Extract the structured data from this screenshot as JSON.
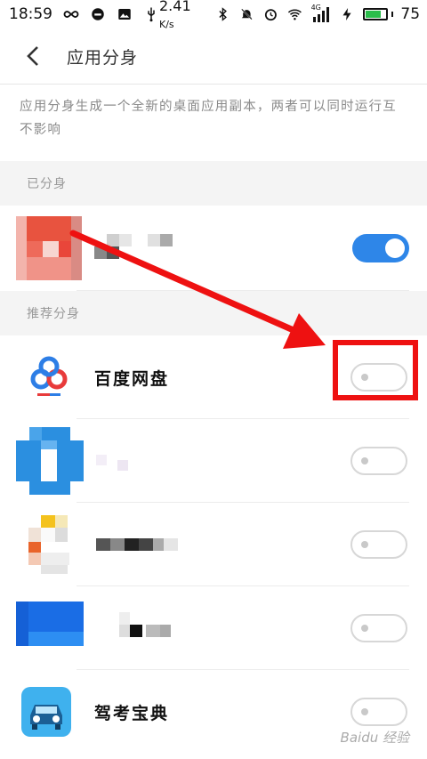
{
  "status_bar": {
    "time": "18:59",
    "speed": "2.41",
    "speed_unit": "K/s",
    "network": "4G",
    "battery_level": "75",
    "battery_fraction": 0.75
  },
  "header": {
    "title": "应用分身",
    "back_icon": "chevron-left-icon"
  },
  "description": "应用分身生成一个全新的桌面应用副本，两者可以同时运行互不影响",
  "sections": {
    "cloned": {
      "label": "已分身",
      "apps": [
        {
          "name": "",
          "enabled": true
        }
      ]
    },
    "recommended": {
      "label": "推荐分身",
      "apps": [
        {
          "name": "百度网盘",
          "enabled": false
        },
        {
          "name": "",
          "enabled": false
        },
        {
          "name": "",
          "enabled": false
        },
        {
          "name": "",
          "enabled": false
        },
        {
          "name": "驾考宝典",
          "enabled": false
        }
      ]
    }
  },
  "colors": {
    "toggle_on": "#2e86e8",
    "annotation_red": "#ee1111"
  },
  "watermark": "Baidu 经验"
}
